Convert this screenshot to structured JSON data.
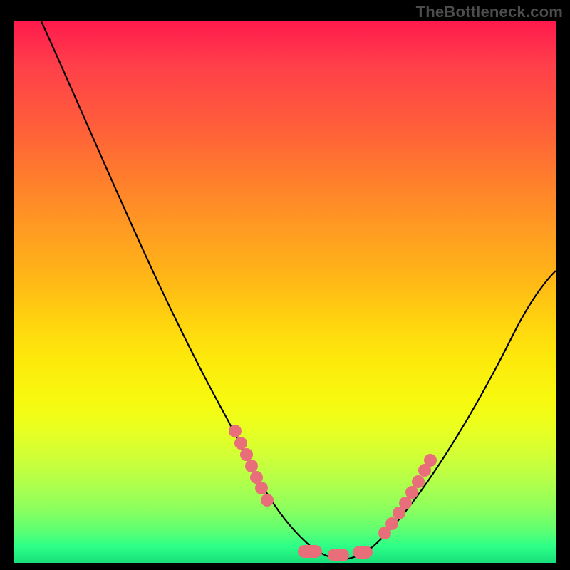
{
  "watermark": "TheBottleneck.com",
  "chart_data": {
    "type": "line",
    "title": "",
    "xlabel": "",
    "ylabel": "",
    "xlim": [
      0,
      100
    ],
    "ylim": [
      0,
      100
    ],
    "curve": {
      "x": [
        5,
        10,
        15,
        20,
        25,
        30,
        35,
        40,
        45,
        50,
        55,
        60,
        63,
        70,
        75,
        80,
        85,
        90,
        95,
        100
      ],
      "y": [
        100,
        93,
        85,
        76,
        67,
        58,
        48,
        38,
        28,
        18,
        8,
        2,
        0,
        4,
        11,
        20,
        29,
        38,
        46,
        53
      ]
    },
    "markers": {
      "x": [
        40.5,
        42,
        43.5,
        45,
        50,
        53,
        55,
        56.5,
        58,
        61,
        63,
        65,
        66,
        67,
        68,
        70,
        71.5,
        73
      ],
      "y": [
        33,
        30,
        27,
        25,
        15,
        8,
        4,
        2,
        1,
        0,
        0,
        1,
        2,
        3,
        5,
        8,
        11,
        14
      ]
    },
    "marker_style": {
      "color": "#e86f7a",
      "radius_px": 9,
      "pill_cluster": true
    },
    "background_gradient": {
      "top": "#ff1a4d",
      "upper_mid": "#ff9a22",
      "mid": "#ffd60e",
      "lower_mid": "#eaff1f",
      "bottom": "#18e07a"
    },
    "line_color": "#000000"
  }
}
